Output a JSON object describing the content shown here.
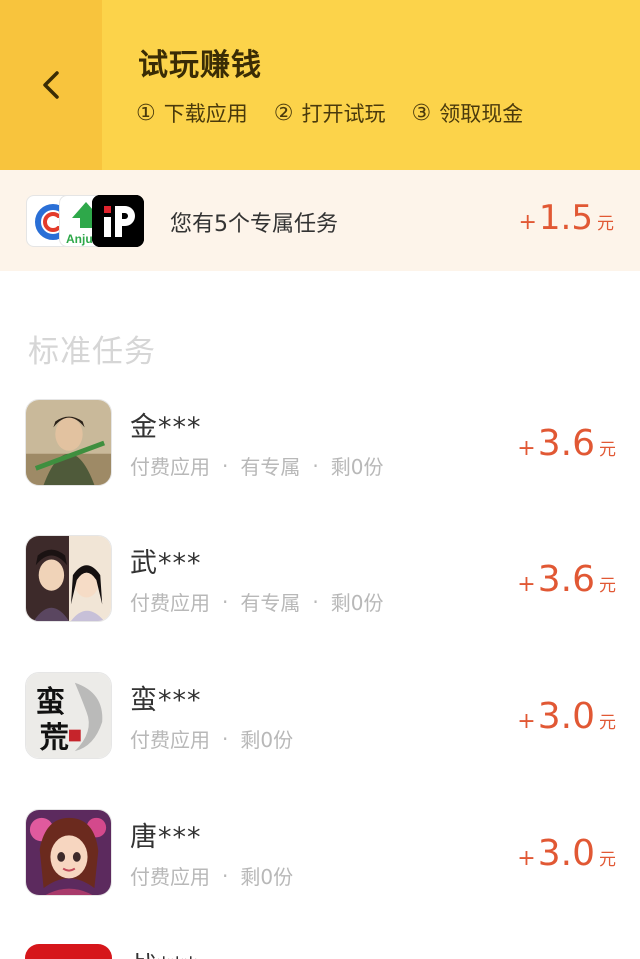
{
  "header": {
    "title": "试玩赚钱",
    "steps": [
      {
        "num": "①",
        "label": "下载应用"
      },
      {
        "num": "②",
        "label": "打开试玩"
      },
      {
        "num": "③",
        "label": "领取现金"
      }
    ]
  },
  "exclusive": {
    "text": "您有5个专属任务",
    "plus": "+",
    "amount": "1.5",
    "unit": "元",
    "icon2_text": "Anju"
  },
  "section_title": "标准任务",
  "tasks": [
    {
      "name": "金***",
      "meta": [
        "付费应用",
        "有专属",
        "剩0份"
      ],
      "plus": "+",
      "amount": "3.6",
      "unit": "元"
    },
    {
      "name": "武***",
      "meta": [
        "付费应用",
        "有专属",
        "剩0份"
      ],
      "plus": "+",
      "amount": "3.6",
      "unit": "元"
    },
    {
      "name": "蛮***",
      "meta": [
        "付费应用",
        "剩0份"
      ],
      "plus": "+",
      "amount": "3.0",
      "unit": "元",
      "icon_text": "蛮荒"
    },
    {
      "name": "唐***",
      "meta": [
        "付费应用",
        "剩0份"
      ],
      "plus": "+",
      "amount": "3.0",
      "unit": "元"
    }
  ],
  "meta_separator": "·",
  "partial_task": {
    "name": "战***"
  },
  "colors": {
    "header_bg": "#fcd34a",
    "back_bg": "#f8c43d",
    "exclusive_bg": "#fdf4ea",
    "reward": "#e15834",
    "meta": "#b8b8b8"
  }
}
